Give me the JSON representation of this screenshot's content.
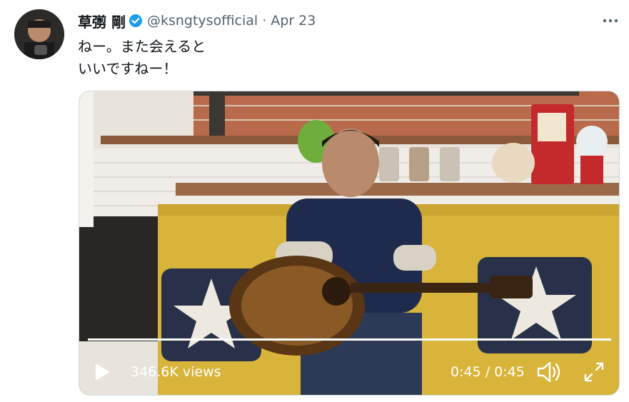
{
  "tweet": {
    "author_name": "草彅 剛",
    "handle": "@ksngtysofficial",
    "separator": "·",
    "date": "Apr 23",
    "text_line1": "ねー。また会えると",
    "text_line2": "いいですねー！",
    "verified_icon": "verified-badge-icon",
    "more_icon": "more-options-icon"
  },
  "video": {
    "views": "346.6K views",
    "time": "0:45 / 0:45",
    "progress": 1.0,
    "play_icon": "play-icon",
    "volume_icon": "volume-icon",
    "fullscreen_icon": "fullscreen-icon"
  },
  "colors": {
    "accent": "#1d9bf0",
    "text": "#0f1419",
    "muted": "#536471"
  }
}
